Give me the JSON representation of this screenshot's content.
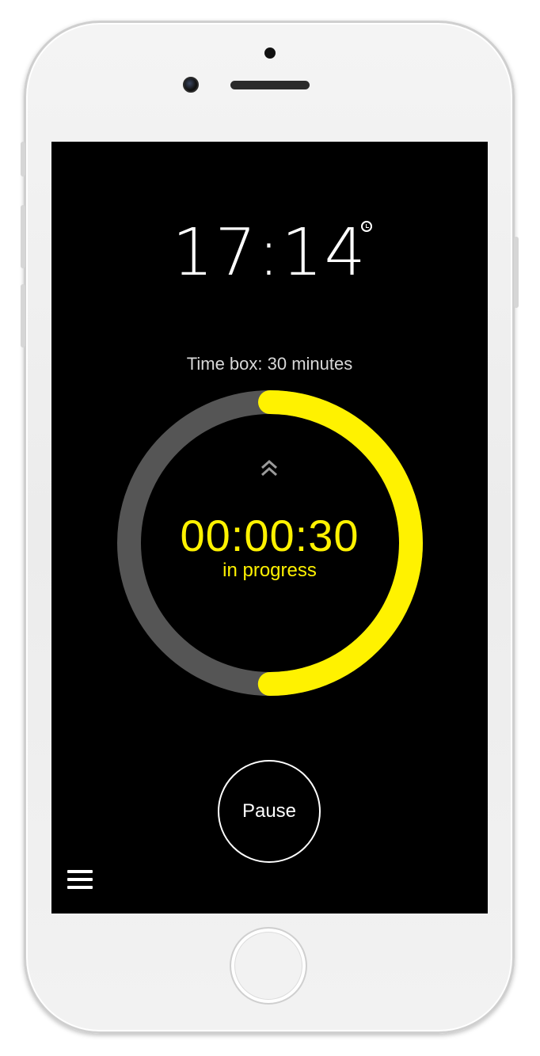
{
  "clock": {
    "time": "17:14",
    "alarm_icon": "alarm-clock-icon"
  },
  "timer": {
    "timebox_label": "Time box: 30 minutes",
    "elapsed": "00:00:30",
    "status": "in progress",
    "progress_fraction": 0.5,
    "expand_icon": "double-chevron-up-icon"
  },
  "controls": {
    "pause_label": "Pause",
    "menu_icon": "hamburger-menu-icon"
  },
  "colors": {
    "accent": "#FFF200",
    "track": "#555555",
    "background": "#000000",
    "text": "#FFFFFF"
  }
}
